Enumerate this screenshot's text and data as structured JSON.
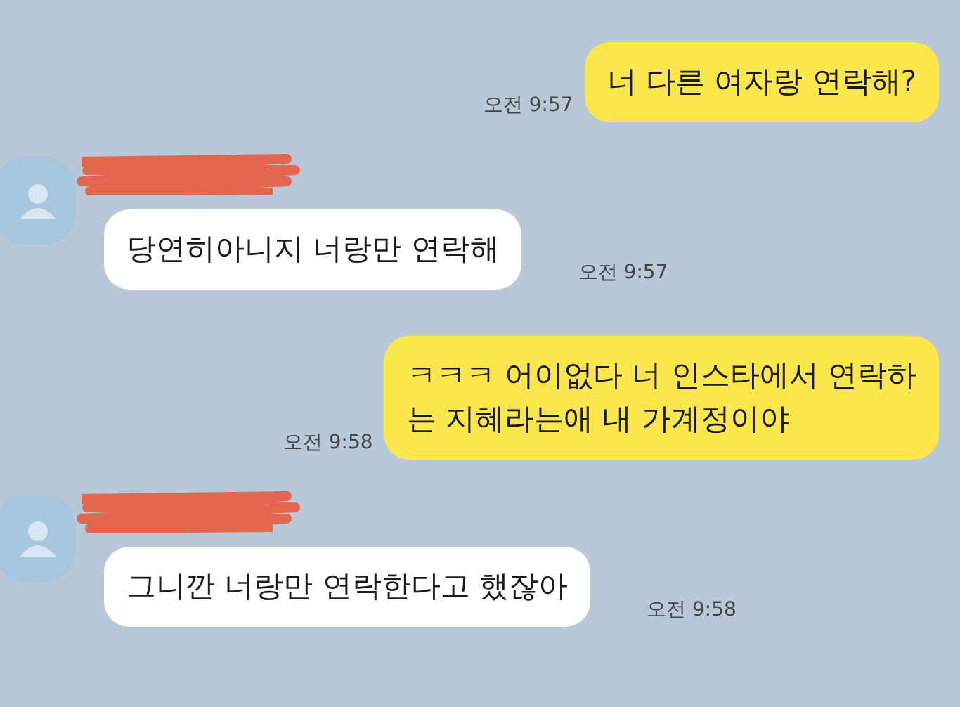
{
  "messages": [
    {
      "kind": "sent",
      "lines": [
        "너 다른 여자랑 연락해?"
      ],
      "time": "오전 9:57"
    },
    {
      "kind": "received",
      "lines": [
        "당연히아니지 너랑만 연락해"
      ],
      "time": "오전 9:57"
    },
    {
      "kind": "sent",
      "lines": [
        "ㅋㅋㅋ 어이없다 너 인스타에서 연락하",
        "는 지혜라는애 내 가계정이야"
      ],
      "time": "오전 9:58"
    },
    {
      "kind": "received",
      "lines": [
        "그니깐 너랑만 연락한다고 했잖아"
      ],
      "time": "오전 9:58"
    }
  ]
}
